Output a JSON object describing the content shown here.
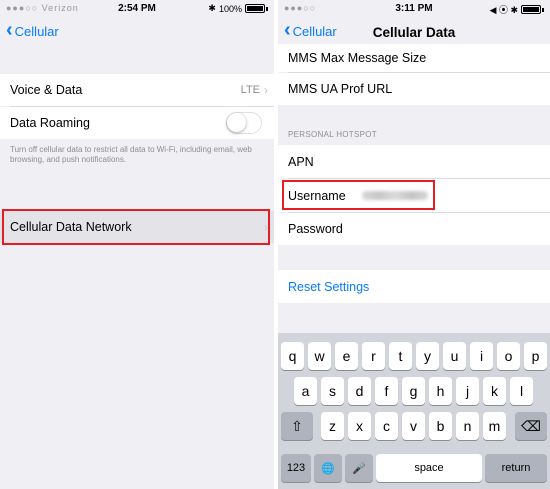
{
  "left_screen": {
    "status": {
      "carrier": "●●●○○ Verizon",
      "time": "2:54 PM",
      "indicators": "✱",
      "battery_pct": "100%"
    },
    "nav": {
      "back_label": "Cellular"
    },
    "rows": {
      "voice_data": {
        "label": "Voice & Data",
        "value": "LTE"
      },
      "data_roaming": {
        "label": "Data Roaming",
        "enabled": false
      },
      "footnote": "Turn off cellular data to restrict all data to Wi-Fi, including email, web browsing, and push notifications.",
      "cellular_data_network": {
        "label": "Cellular Data Network"
      }
    }
  },
  "right_screen": {
    "status": {
      "carrier": "●●●○○ ",
      "time": "3:11 PM",
      "indicators": "◀ ⦿ ✱"
    },
    "nav": {
      "back_label": "Cellular",
      "title": "Cellular Data"
    },
    "rows": {
      "mms_max": "MMS Max Message Size",
      "mms_ua": "MMS UA Prof URL",
      "section_header": "PERSONAL HOTSPOT",
      "apn": "APN",
      "username": "Username",
      "password": "Password",
      "reset": "Reset Settings"
    },
    "keyboard": {
      "row1": [
        "q",
        "w",
        "e",
        "r",
        "t",
        "y",
        "u",
        "i",
        "o",
        "p"
      ],
      "row2": [
        "a",
        "s",
        "d",
        "f",
        "g",
        "h",
        "j",
        "k",
        "l"
      ],
      "row3": [
        "z",
        "x",
        "c",
        "v",
        "b",
        "n",
        "m"
      ],
      "numbers": "123",
      "space": "space",
      "return": "return",
      "shift_icon": "⇧",
      "delete_icon": "⌫",
      "globe_icon": "🌐",
      "mic_icon": "🎤"
    }
  },
  "colors": {
    "accent": "#0a7bff",
    "highlight": "#e31e24",
    "background": "#efeff4"
  }
}
